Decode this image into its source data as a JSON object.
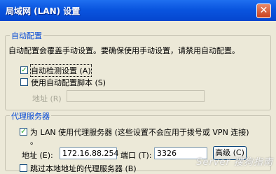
{
  "window": {
    "title": "局域网 (LAN) 设置",
    "close_icon": "close-icon",
    "close_glyph": "✕"
  },
  "auto_config": {
    "legend": "自动配置",
    "description": "自动配置会覆盖手动设置。要确保使用手动设置，请禁用自动配置。",
    "auto_detect": {
      "label": "自动检测设置 (A)",
      "checked": true
    },
    "use_script": {
      "label": "使用自动配置脚本 (S)",
      "checked": false
    },
    "address_label": "地址 (R)",
    "address_value": ""
  },
  "proxy": {
    "legend": "代理服务器",
    "use_proxy": {
      "label_line1": "为 LAN 使用代理服务器 (这些设置不会应用于拨号或 VPN 连接)",
      "label_line2": "。",
      "checked": true
    },
    "address_label": "地址 (E):",
    "address_value": "172.16.88.254",
    "port_label": "端口 (T):",
    "port_value": "3326",
    "advanced_button": "高级 (C)",
    "bypass_local": {
      "label": "跳过本地地址的代理服务器 (B)",
      "checked": false
    }
  },
  "watermark": "Server 搜狗指南"
}
